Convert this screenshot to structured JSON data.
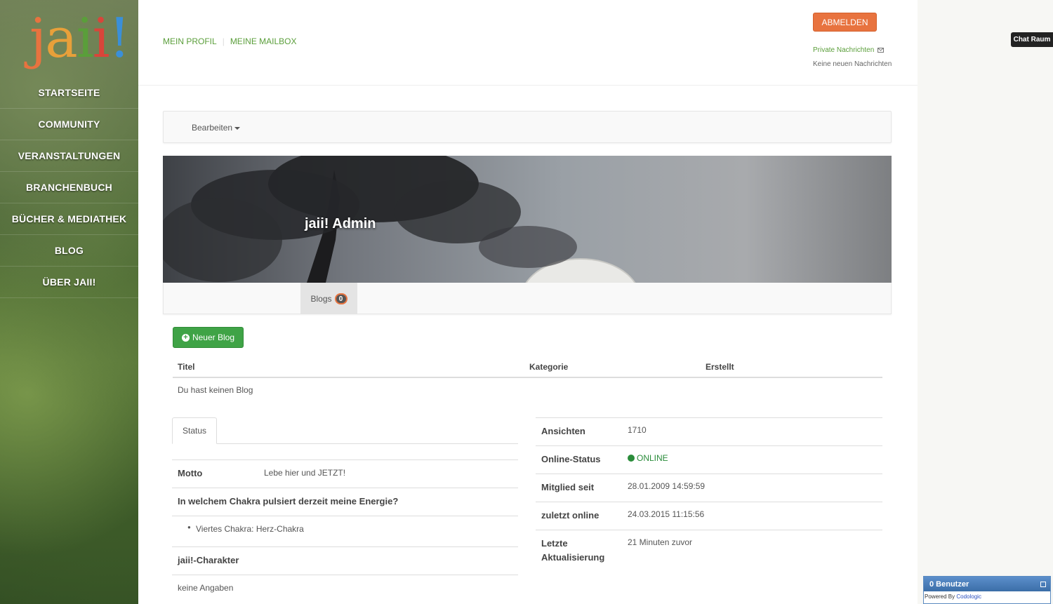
{
  "logo": {
    "letters": [
      "j",
      "a",
      "i",
      "i",
      "!"
    ],
    "colors": [
      "#e8733f",
      "#e8a03a",
      "#5a9e3a",
      "#d9453a",
      "#3a8fd9"
    ]
  },
  "sidebar": {
    "items": [
      {
        "label": "STARTSEITE"
      },
      {
        "label": "COMMUNITY"
      },
      {
        "label": "VERANSTALTUNGEN"
      },
      {
        "label": "BRANCHENBUCH"
      },
      {
        "label": "BÜCHER & MEDIATHEK"
      },
      {
        "label": "BLOG"
      },
      {
        "label": "ÜBER JAII!"
      }
    ]
  },
  "header": {
    "nav": [
      "MEIN PROFIL",
      "MEINE MAILBOX"
    ],
    "logout": "ABMELDEN",
    "private_messages": "Private Nachrichten",
    "no_messages": "Keine neuen Nachrichten"
  },
  "chat": {
    "label": "Chat Raum",
    "users": "0 Benutzer",
    "powered_by": "Powered By ",
    "powered_brand": "Codologic"
  },
  "edit_menu": {
    "label": "Bearbeiten"
  },
  "cover": {
    "name": "jaii! Admin"
  },
  "tabs": {
    "blogs_label": "Blogs",
    "blogs_count": "0"
  },
  "blog": {
    "new_button": "Neuer Blog",
    "columns": [
      "Titel",
      "Kategorie",
      "Erstellt"
    ],
    "empty": "Du hast keinen Blog"
  },
  "profile_left": {
    "tab": "Status",
    "motto_label": "Motto",
    "motto_value": "Lebe hier und JETZT!",
    "chakra_question": "In welchem Chakra pulsiert derzeit meine Energie?",
    "chakra_answer": "Viertes Chakra: Herz-Chakra",
    "character_label": "jaii!-Charakter",
    "character_value": "keine Angaben"
  },
  "profile_right": {
    "views_label": "Ansichten",
    "views_value": "1710",
    "online_label": "Online-Status",
    "online_value": "ONLINE",
    "member_label": "Mitglied seit",
    "member_value": "28.01.2009 14:59:59",
    "last_online_label": "zuletzt online",
    "last_online_value": "24.03.2015 11:15:56",
    "last_update_label": "Letzte Aktualisierung",
    "last_update_value": "21 Minuten zuvor"
  }
}
